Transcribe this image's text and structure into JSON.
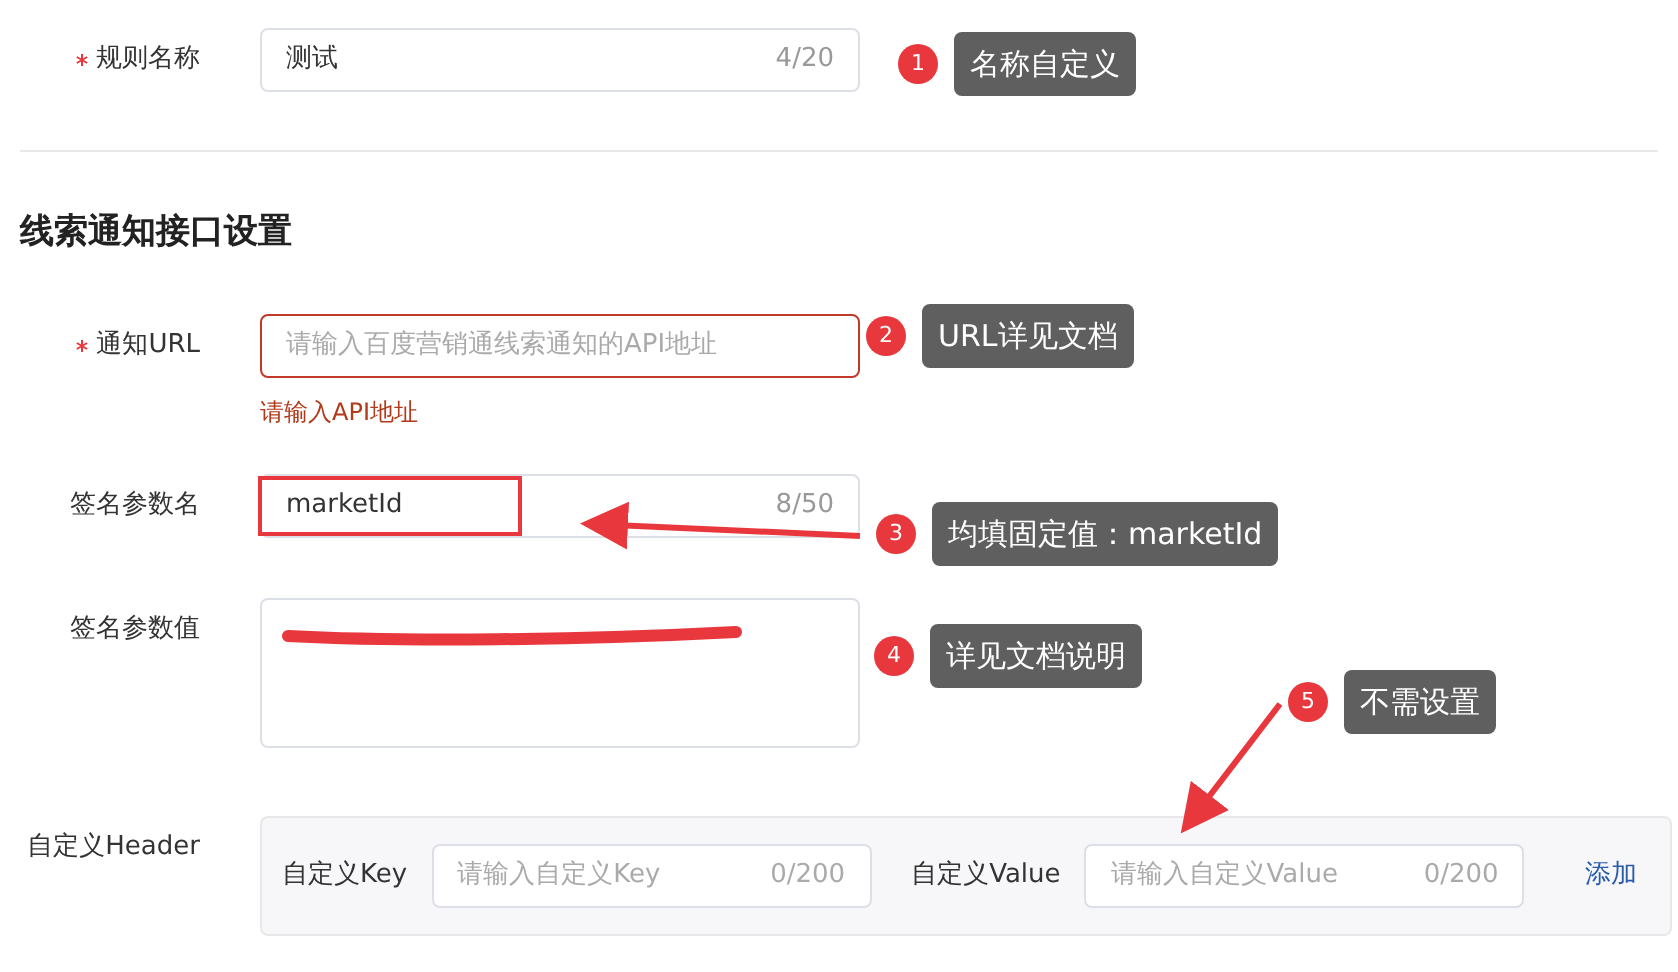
{
  "rule_name": {
    "label": "规则名称",
    "required": true,
    "value": "测试",
    "counter": "4/20"
  },
  "section_title": "线索通知接口设置",
  "notify_url": {
    "label": "通知URL",
    "required": true,
    "placeholder": "请输入百度营销通线索通知的API地址",
    "error": "请输入API地址"
  },
  "sign_name": {
    "label": "签名参数名",
    "required": false,
    "value": "marketId",
    "counter": "8/50",
    "highlighted": true
  },
  "sign_value": {
    "label": "签名参数值",
    "required": false,
    "redacted": true
  },
  "custom_header": {
    "label": "自定义Header",
    "key_label": "自定义Key",
    "key_placeholder": "请输入自定义Key",
    "key_counter": "0/200",
    "value_label": "自定义Value",
    "value_placeholder": "请输入自定义Value",
    "value_counter": "0/200",
    "add_link": "添加"
  },
  "annotations": [
    {
      "number": "1",
      "text": "名称自定义"
    },
    {
      "number": "2",
      "text": "URL详见文档"
    },
    {
      "number": "3",
      "text": "均填固定值：marketId"
    },
    {
      "number": "4",
      "text": "详见文档说明"
    },
    {
      "number": "5",
      "text": "不需设置"
    }
  ]
}
